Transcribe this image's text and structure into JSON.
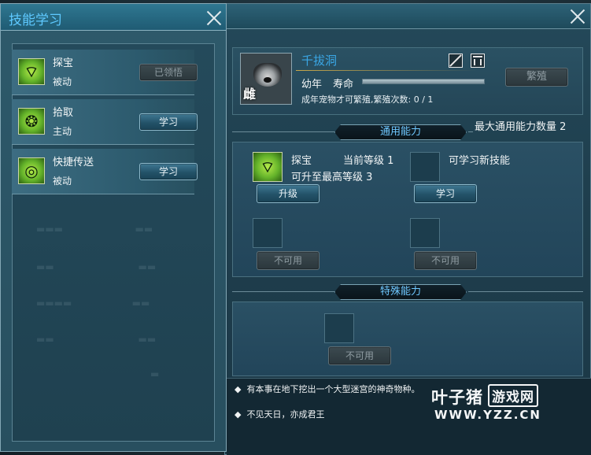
{
  "skill_learn_panel": {
    "title": "技能学习",
    "skills": [
      {
        "name": "探宝",
        "type": "被动",
        "action_label": "已领悟",
        "action_enabled": false,
        "icon": "treasure-signal-icon"
      },
      {
        "name": "拾取",
        "type": "主动",
        "action_label": "学习",
        "action_enabled": true,
        "icon": "paw-pickup-icon"
      },
      {
        "name": "快捷传送",
        "type": "被动",
        "action_label": "学习",
        "action_enabled": true,
        "icon": "teleport-ring-icon"
      }
    ]
  },
  "pet_panel": {
    "pet_name": "千拔洞",
    "gender": "雌",
    "age_stage": "幼年",
    "life_label": "寿命",
    "life_fraction": 1.0,
    "breed_button": "繁殖",
    "breed_note": "成年宠物才可繁殖,繁殖次数: 0 / 1",
    "general_ability": {
      "header": "通用能力",
      "max_count_label": "最大通用能力数量 2",
      "slot1": {
        "name": "探宝",
        "current_level": "当前等级 1",
        "max_level": "可升至最高等级 3",
        "button": "升级"
      },
      "slot2": {
        "label": "可学习新技能",
        "button": "学习"
      },
      "slot3_button": "不可用",
      "slot4_button": "不可用"
    },
    "special_ability": {
      "header": "特殊能力",
      "slot_button": "不可用"
    },
    "descriptions": [
      "有本事在地下挖出一个大型迷宫的神奇物种。",
      "不见天日，亦成君王"
    ]
  },
  "watermark": {
    "main": "叶子猪",
    "badge": "游戏网",
    "sub": "WWW.YZZ.CN"
  }
}
